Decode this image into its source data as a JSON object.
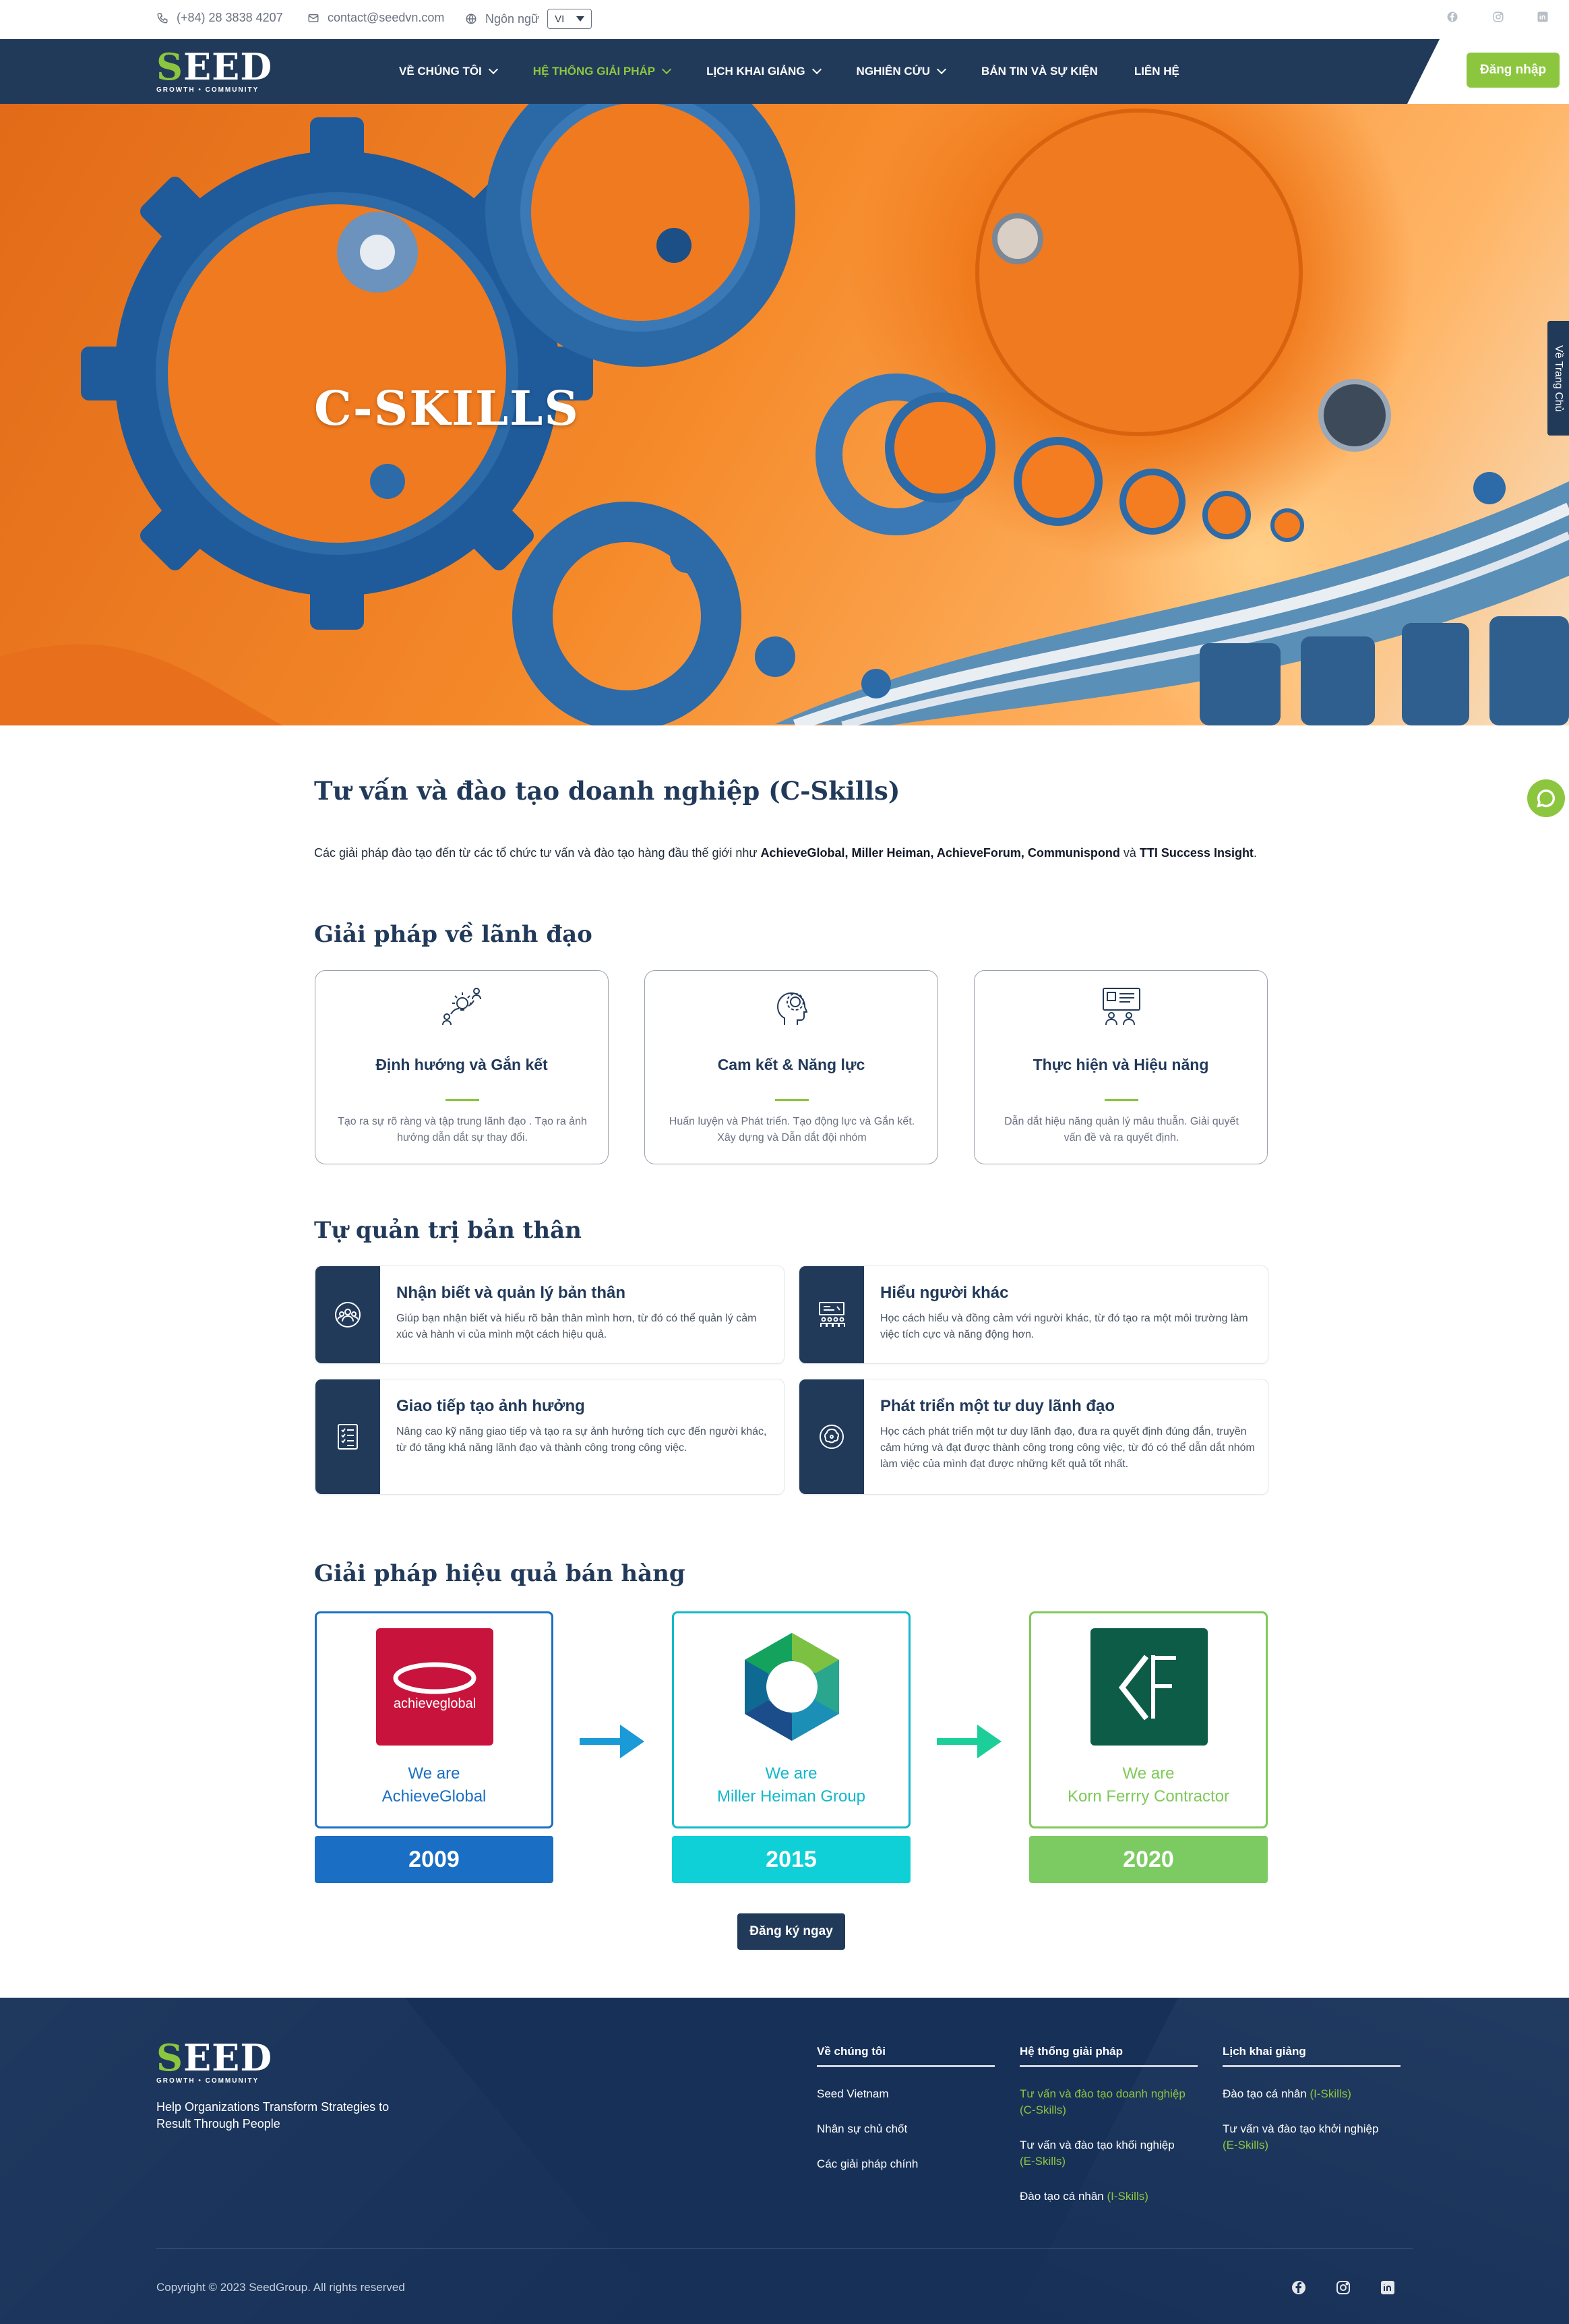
{
  "topbar": {
    "phone": "(+84) 28 3838 4207",
    "email": "contact@seedvn.com",
    "language_label": "Ngôn ngữ",
    "language_value": "VI"
  },
  "brand": {
    "name": "SEED",
    "tagline": "GROWTH • COMMUNITY",
    "accent": "#8cc63f",
    "navy": "#223a5a"
  },
  "nav": {
    "items": [
      {
        "label": "VỀ CHÚNG TÔI",
        "dropdown": true
      },
      {
        "label": "HỆ THỐNG GIẢI PHÁP",
        "dropdown": true,
        "active": true
      },
      {
        "label": "LỊCH KHAI GIẢNG",
        "dropdown": true
      },
      {
        "label": "NGHIÊN CỨU",
        "dropdown": true
      },
      {
        "label": "BẢN TIN VÀ SỰ KIỆN",
        "dropdown": false
      },
      {
        "label": "LIÊN HỆ",
        "dropdown": false
      }
    ],
    "login_label": "Đăng nhập"
  },
  "hero": {
    "title": "C-SKILLS",
    "side_tab": "Về Trang Chủ"
  },
  "intro": {
    "heading": "Tư vấn và đào tạo doanh nghiệp (C-Skills)",
    "text_before": "Các giải pháp đào tạo đến từ các tổ chức tư vấn và đào tạo hàng đầu thế giới như ",
    "brands": "AchieveGlobal, Miller Heiman, AchieveForum, Communispond",
    "and": " và ",
    "last_brand": "TTI Success Insight",
    "end": "."
  },
  "leadership": {
    "heading": "Giải pháp về lãnh đạo",
    "cards": [
      {
        "title": "Định hướng và Gắn kết",
        "desc": "Tạo ra sự rõ ràng và tập trung lãnh đạo . Tạo ra ảnh hưởng dẫn dắt sự thay đổi.",
        "icon": "idea-flow-icon"
      },
      {
        "title": "Cam kết & Năng lực",
        "desc": "Huấn luyện và Phát triển. Tạo động lực và Gắn kết. Xây dựng và Dẫn dắt đội nhóm",
        "icon": "head-gear-icon"
      },
      {
        "title": "Thực hiện và Hiệu năng",
        "desc": "Dẫn dắt hiệu năng quản lý mâu thuẫn. Giải quyết vấn đề và ra quyết định.",
        "icon": "presentation-icon"
      }
    ]
  },
  "self_management": {
    "heading": "Tự quản trị bản thân",
    "cards": [
      {
        "title": "Nhận biết và quản lý bản thân",
        "desc": "Giúp bạn nhận biết và hiểu rõ bản thân mình hơn, từ đó có thể quản lý cảm xúc và hành vi của mình một cách hiệu quả.",
        "icon": "people-circle-icon"
      },
      {
        "title": "Hiểu người khác",
        "desc": "Học cách hiểu và đồng cảm với người khác, từ đó tạo ra một môi trường làm việc tích cực và năng động hơn.",
        "icon": "meeting-board-icon"
      },
      {
        "title": "Giao tiếp tạo ảnh hưởng",
        "desc": "Nâng cao kỹ năng giao tiếp và tạo ra sự ảnh hưởng tích cực đến người khác, từ đó tăng khả năng lãnh đạo và thành công trong công việc.",
        "icon": "checklist-icon"
      },
      {
        "title": "Phát triển một tư duy lãnh đạo",
        "desc": "Học cách phát triển một tư duy lãnh đạo, đưa ra quyết định đúng đắn, truyền cảm hứng và đạt được thành công trong công việc, từ đó có thể dẫn dắt nhóm làm việc của mình đạt được những kết quả tốt nhất.",
        "icon": "brain-network-icon"
      }
    ]
  },
  "sales": {
    "heading": "Giải pháp hiệu quả bán hàng",
    "steps": [
      {
        "we": "We are",
        "name": "AchieveGlobal",
        "year": "2009",
        "logo_text": "achieveglobal",
        "color": "#1a6fc4",
        "logo_bg": "#c8143c"
      },
      {
        "we": "We are",
        "name": "Miller Heiman Group",
        "year": "2015",
        "color": "#12b8c9",
        "logo_bg": "#ffffff"
      },
      {
        "we": "We are",
        "name": "Korn Ferrry Contractor",
        "year": "2020",
        "color": "#7fc95a",
        "logo_bg": "#0d5c48"
      }
    ],
    "year_colors": [
      "#1a6fc4",
      "#0fd0d6",
      "#7ccb62"
    ],
    "cta": "Đăng ký ngay"
  },
  "footer": {
    "tagline": "Help Organizations Transform Strategies to Result Through People",
    "columns": [
      {
        "heading": "Về chúng tôi",
        "links": [
          "Seed Vietnam",
          "Nhân sự chủ chốt",
          "Các giải pháp chính"
        ]
      },
      {
        "heading": "Hệ thống giải pháp",
        "links": [
          "Tư vấn và đào tạo doanh nghiệp (C-Skills)",
          "Tư vấn và đào tạo khối nghiệp",
          "(E-Skills)",
          "Đào tạo cá nhân",
          "(I-Skills)"
        ]
      },
      {
        "heading": "Lịch khai giảng",
        "links": [
          "Đào tạo cá nhân",
          "(I-Skills)",
          "Tư vấn và đào tạo khởi nghiệp",
          "(E-Skills)"
        ]
      }
    ],
    "copyright": "Copyright © 2023 SeedGroup. All rights reserved"
  }
}
